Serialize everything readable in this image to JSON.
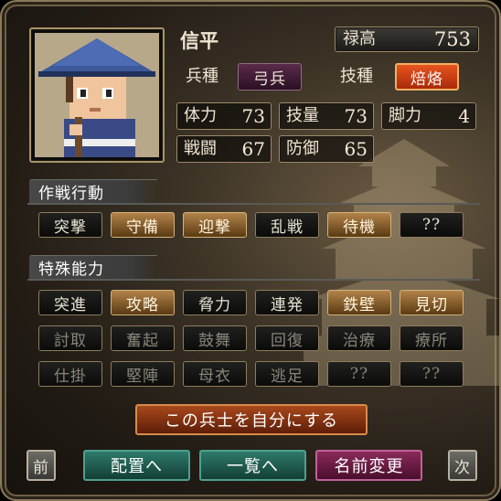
{
  "unit": {
    "name": "信平",
    "heidan_label": "兵種",
    "heidan_value": "弓兵",
    "gishu_label": "技種",
    "gishu_value": "焙烙",
    "stipend_label": "禄高",
    "stipend_value": "753"
  },
  "stats": [
    {
      "label": "体力",
      "value": "73"
    },
    {
      "label": "技量",
      "value": "73"
    },
    {
      "label": "脚力",
      "value": "4"
    },
    {
      "label": "戦闘",
      "value": "67"
    },
    {
      "label": "防御",
      "value": "65"
    }
  ],
  "tactics": {
    "title": "作戦行動",
    "items": [
      {
        "label": "突撃",
        "active": false
      },
      {
        "label": "守備",
        "active": true
      },
      {
        "label": "迎撃",
        "active": true
      },
      {
        "label": "乱戦",
        "active": false
      },
      {
        "label": "待機",
        "active": true
      },
      {
        "label": "??",
        "active": false
      }
    ]
  },
  "abilities": {
    "title": "特殊能力",
    "rows": [
      [
        {
          "label": "突進",
          "active": false
        },
        {
          "label": "攻略",
          "active": true
        },
        {
          "label": "脅力",
          "active": false
        },
        {
          "label": "連発",
          "active": false
        },
        {
          "label": "鉄壁",
          "active": true
        },
        {
          "label": "見切",
          "active": true
        }
      ],
      [
        {
          "label": "討取",
          "active": false
        },
        {
          "label": "奮起",
          "active": false
        },
        {
          "label": "鼓舞",
          "active": false
        },
        {
          "label": "回復",
          "active": false
        },
        {
          "label": "治療",
          "active": false
        },
        {
          "label": "療所",
          "active": false
        }
      ],
      [
        {
          "label": "仕掛",
          "active": false
        },
        {
          "label": "堅陣",
          "active": false
        },
        {
          "label": "母衣",
          "active": false
        },
        {
          "label": "逃足",
          "active": false
        },
        {
          "label": "??",
          "active": false
        },
        {
          "label": "??",
          "active": false
        }
      ]
    ]
  },
  "actions": {
    "make_own": "この兵士を自分にする",
    "prev": "前",
    "deploy": "配置へ",
    "list": "一覧へ",
    "rename": "名前変更",
    "next": "次"
  },
  "colors": {
    "active_button": "#b2834a",
    "teal_button": "#1f5e52",
    "magenta_button": "#6a1c44",
    "orange_button": "#8f3818",
    "highlight_red": "#d23a14"
  }
}
